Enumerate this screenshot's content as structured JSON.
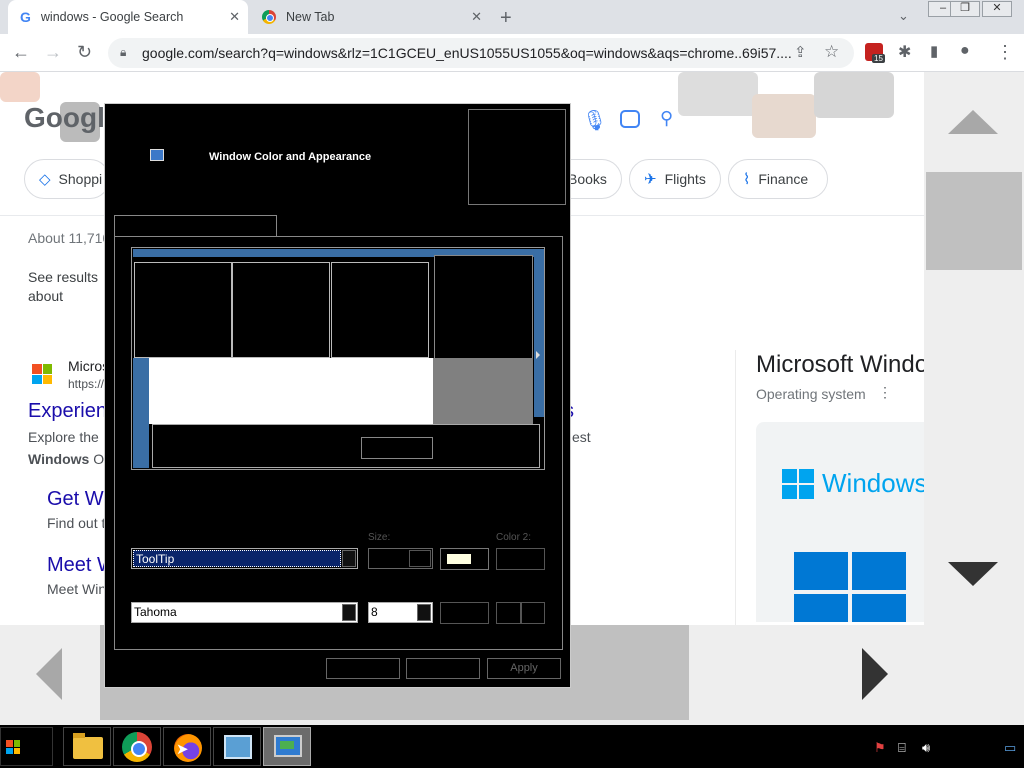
{
  "browser": {
    "tabs": [
      {
        "title": "windows - Google Search",
        "favicon": "google-g-icon",
        "active": true
      },
      {
        "title": "New Tab",
        "favicon": "chrome-icon",
        "active": false
      }
    ],
    "url": "google.com/search?q=windows&rlz=1C1GCEU_enUS1055US1055&oq=windows&aqs=chrome..69i57....",
    "extension_badge_count": "15"
  },
  "google": {
    "logo_text": "Google",
    "chips": [
      {
        "label": "Shoppi",
        "icon": "tag-icon"
      },
      {
        "label": "Books",
        "icon": ""
      },
      {
        "label": "Flights",
        "icon": "plane-icon"
      },
      {
        "label": "Finance",
        "icon": "chart-icon"
      }
    ],
    "about_results": "About 11,710",
    "see_results_about": "See results about",
    "result": {
      "site": "Micros",
      "url": "https://",
      "title": "Experien",
      "title_tail": "s",
      "snippet": "Explore the",
      "snippet_tail": "est",
      "snippet2_bold": "Windows",
      "snippet2_rest": " O"
    },
    "sublinks": [
      {
        "title": "Get W",
        "snippet": "Find out t"
      },
      {
        "title": "Meet W",
        "snippet": "Meet Win"
      }
    ],
    "knowledge_panel": {
      "title": "Microsoft Windo",
      "subtitle": "Operating system",
      "logo_text": "Windows"
    }
  },
  "dialog": {
    "title": "Window Color and Appearance",
    "labels": {
      "size": "Size:",
      "color2": "Color 2:"
    },
    "item_value": "ToolTip",
    "font_value": "Tahoma",
    "font_size_value": "8",
    "color1": "#ffffe1",
    "buttons": {
      "ok": "",
      "cancel": "",
      "apply": "Apply"
    }
  },
  "taskbar": {
    "apps": [
      {
        "name": "file-explorer"
      },
      {
        "name": "chrome"
      },
      {
        "name": "firefox"
      },
      {
        "name": "control-panel"
      },
      {
        "name": "display-settings",
        "active": true
      }
    ]
  },
  "colors": {
    "accent": "#1a73e8",
    "link": "#1a0dab",
    "dialog_bg": "#000000",
    "selection": "#0a246a"
  }
}
